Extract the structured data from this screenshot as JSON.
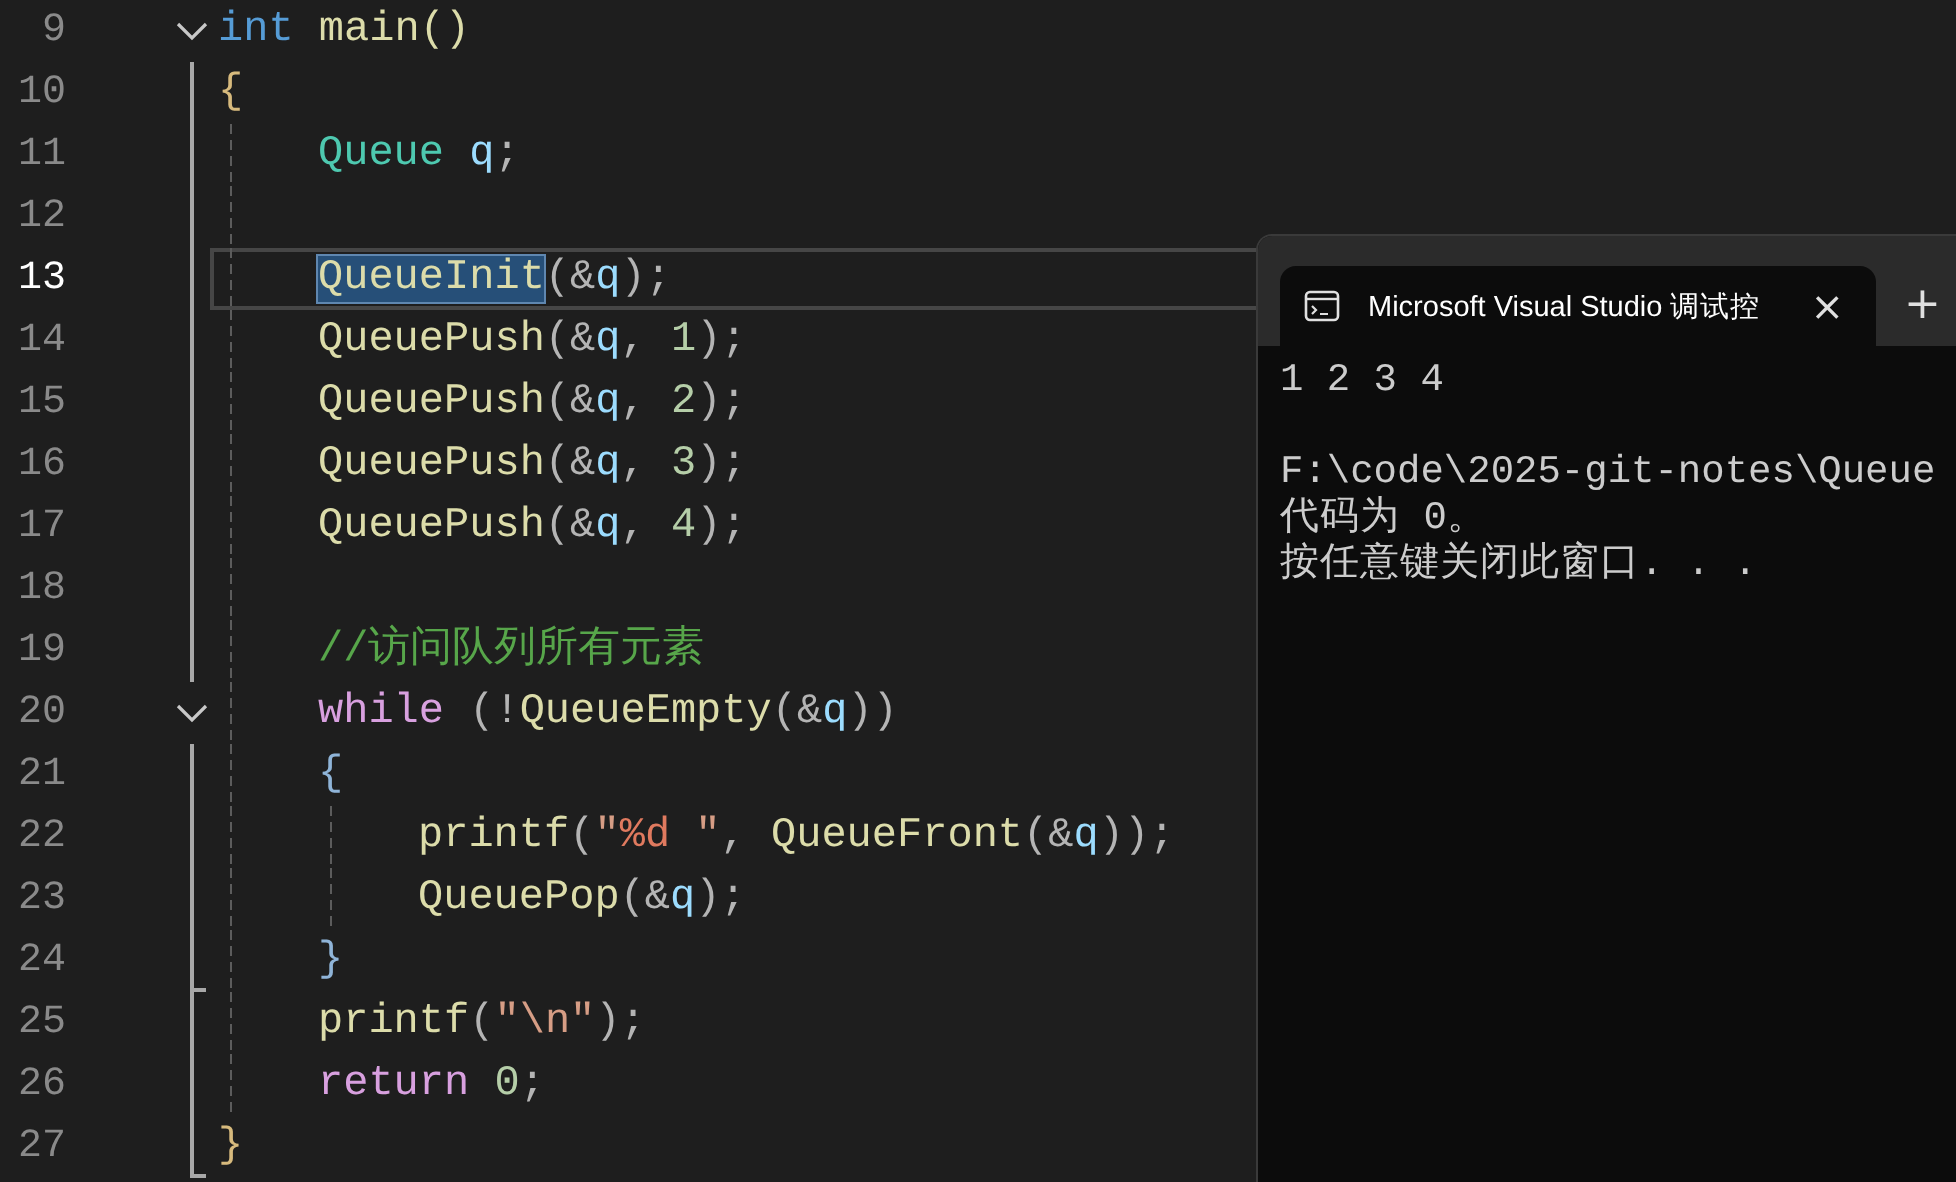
{
  "editor": {
    "lines": [
      {
        "number": "9",
        "current": false,
        "expanded": true,
        "tokens": [
          {
            "text": "int",
            "kind": "keyword"
          },
          {
            "text": " main()",
            "kind": "func"
          }
        ],
        "block": {
          "open": {
            "number": "10",
            "current": false,
            "tokens": [
              {
                "text": "{",
                "kind": "brace"
              }
            ]
          },
          "body": [
            {
              "number": "11",
              "current": false,
              "tokens": [
                {
                  "text": "Queue",
                  "kind": "type"
                },
                {
                  "text": " q",
                  "kind": "var"
                },
                {
                  "text": ";",
                  "kind": "punc"
                }
              ]
            },
            {
              "number": "12",
              "current": false
            },
            {
              "number": "13",
              "current": true,
              "tokens": [
                {
                  "text": "QueueInit",
                  "kind": "func",
                  "selected": true
                },
                {
                  "text": "(&",
                  "kind": "punc",
                  "selected": false
                },
                {
                  "text": "q",
                  "kind": "var",
                  "selected": false
                },
                {
                  "text": ");",
                  "kind": "punc",
                  "selected": false
                }
              ]
            },
            {
              "number": "14",
              "current": false,
              "tokens": [
                {
                  "text": "QueuePush",
                  "kind": "func"
                },
                {
                  "text": "(&",
                  "kind": "punc"
                },
                {
                  "text": "q",
                  "kind": "var"
                },
                {
                  "text": ", ",
                  "kind": "punc"
                },
                {
                  "text": "1",
                  "kind": "num"
                },
                {
                  "text": ");",
                  "kind": "punc"
                }
              ]
            },
            {
              "number": "15",
              "current": false,
              "tokens": [
                {
                  "text": "QueuePush",
                  "kind": "func"
                },
                {
                  "text": "(&",
                  "kind": "punc"
                },
                {
                  "text": "q",
                  "kind": "var"
                },
                {
                  "text": ", ",
                  "kind": "punc"
                },
                {
                  "text": "2",
                  "kind": "num"
                },
                {
                  "text": ");",
                  "kind": "punc"
                }
              ]
            },
            {
              "number": "16",
              "current": false,
              "tokens": [
                {
                  "text": "QueuePush",
                  "kind": "func"
                },
                {
                  "text": "(&",
                  "kind": "punc"
                },
                {
                  "text": "q",
                  "kind": "var"
                },
                {
                  "text": ", ",
                  "kind": "punc"
                },
                {
                  "text": "3",
                  "kind": "num"
                },
                {
                  "text": ");",
                  "kind": "punc"
                }
              ]
            },
            {
              "number": "17",
              "current": false,
              "tokens": [
                {
                  "text": "QueuePush",
                  "kind": "func"
                },
                {
                  "text": "(&",
                  "kind": "punc"
                },
                {
                  "text": "q",
                  "kind": "var"
                },
                {
                  "text": ", ",
                  "kind": "punc"
                },
                {
                  "text": "4",
                  "kind": "num"
                },
                {
                  "text": ");",
                  "kind": "punc"
                }
              ]
            },
            {
              "number": "18",
              "current": false
            },
            {
              "number": "19",
              "current": false,
              "tokens": [
                {
                  "text": "//访问队列所有元素",
                  "kind": "comment"
                }
              ]
            },
            {
              "number": "20",
              "current": false,
              "expanded": true,
              "tokens": [
                {
                  "text": "while",
                  "kind": "control"
                },
                {
                  "text": " (!",
                  "kind": "punc"
                },
                {
                  "text": "QueueEmpty",
                  "kind": "func"
                },
                {
                  "text": "(&",
                  "kind": "punc"
                },
                {
                  "text": "q",
                  "kind": "var"
                },
                {
                  "text": "))",
                  "kind": "punc"
                }
              ],
              "block": {
                "open": {
                  "number": "21",
                  "current": false,
                  "tokens": [
                    {
                      "text": "{",
                      "kind": "brace2"
                    }
                  ]
                },
                "body": [
                  {
                    "number": "22",
                    "current": false,
                    "tokens": [
                      {
                        "text": "printf",
                        "kind": "func"
                      },
                      {
                        "text": "(",
                        "kind": "punc"
                      },
                      {
                        "text": "\"",
                        "kind": "string"
                      },
                      {
                        "text": "%d",
                        "kind": "format"
                      },
                      {
                        "text": " \"",
                        "kind": "string"
                      },
                      {
                        "text": ", ",
                        "kind": "punc"
                      },
                      {
                        "text": "QueueFront",
                        "kind": "func"
                      },
                      {
                        "text": "(&",
                        "kind": "punc"
                      },
                      {
                        "text": "q",
                        "kind": "var"
                      },
                      {
                        "text": "));",
                        "kind": "punc"
                      }
                    ]
                  },
                  {
                    "number": "23",
                    "current": false,
                    "tokens": [
                      {
                        "text": "QueuePop",
                        "kind": "func"
                      },
                      {
                        "text": "(&",
                        "kind": "punc"
                      },
                      {
                        "text": "q",
                        "kind": "var"
                      },
                      {
                        "text": ");",
                        "kind": "punc"
                      }
                    ]
                  }
                ],
                "close": {
                  "number": "24",
                  "current": false,
                  "tokens": [
                    {
                      "text": "}",
                      "kind": "brace2"
                    }
                  ]
                }
              }
            },
            {
              "number": "25",
              "current": false,
              "tokens": [
                {
                  "text": "printf",
                  "kind": "func"
                },
                {
                  "text": "(",
                  "kind": "punc"
                },
                {
                  "text": "\"\\n\"",
                  "kind": "string"
                },
                {
                  "text": ");",
                  "kind": "punc"
                }
              ]
            },
            {
              "number": "26",
              "current": false,
              "tokens": [
                {
                  "text": "return",
                  "kind": "control"
                },
                {
                  "text": " 0",
                  "kind": "num"
                },
                {
                  "text": ";",
                  "kind": "punc"
                }
              ]
            }
          ],
          "close": {
            "number": "27",
            "current": false,
            "tokens": [
              {
                "text": "}",
                "kind": "brace"
              }
            ]
          }
        }
      }
    ]
  },
  "console": {
    "tab_title": "Microsoft Visual Studio 调试控",
    "close_glyph": "×",
    "new_tab_glyph": "+",
    "paragraphs": [
      [
        "1 2 3 4"
      ],
      [
        "F:\\code\\2025-git-notes\\Queue",
        "代码为 0。",
        "按任意键关闭此窗口. . ."
      ]
    ]
  }
}
